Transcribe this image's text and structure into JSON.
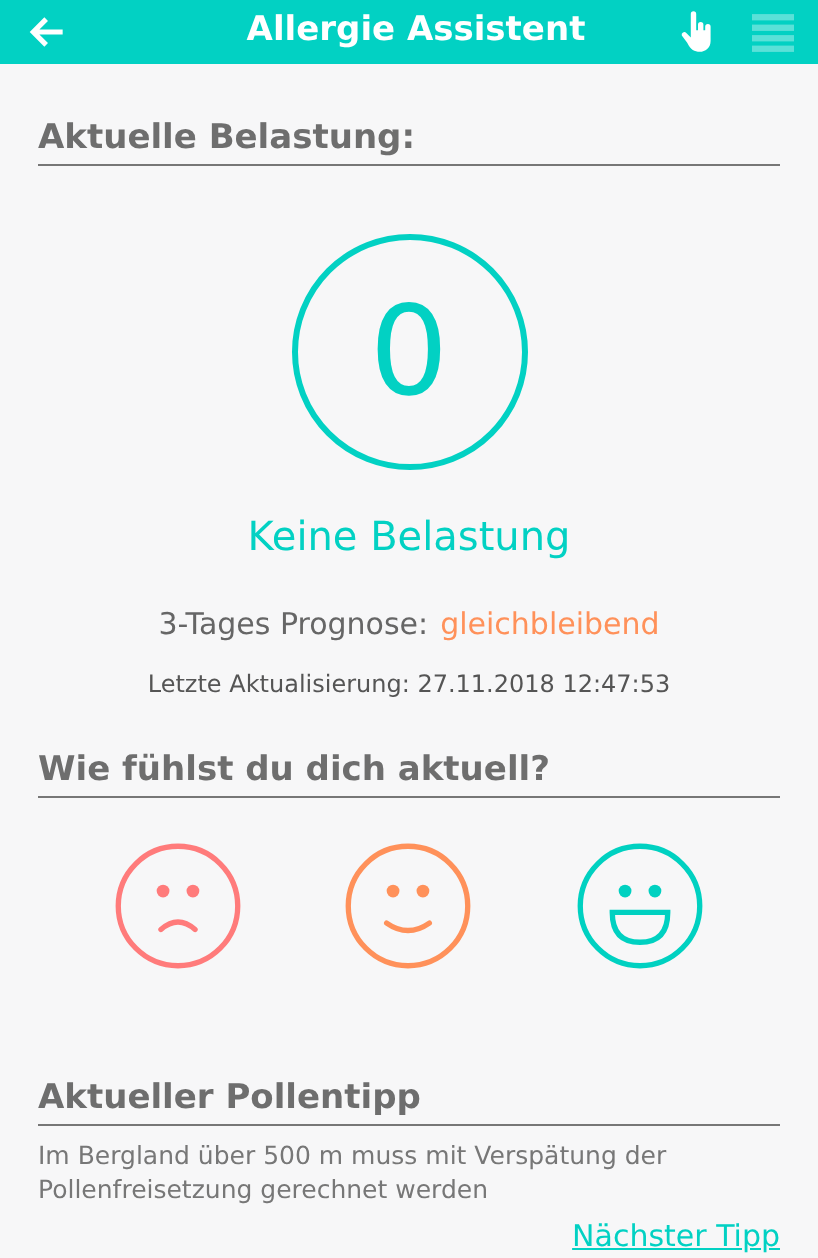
{
  "header": {
    "title": "Allergie Assistent"
  },
  "load": {
    "heading": "Aktuelle Belastung:",
    "value": "0",
    "label": "Keine Belastung",
    "forecast_label": "3-Tages Prognose:",
    "forecast_value": "gleichbleibend",
    "updated": "Letzte Aktualisierung: 27.11.2018 12:47:53"
  },
  "mood": {
    "heading": "Wie fühlst du dich aktuell?",
    "options": [
      {
        "kind": "sad",
        "color": "#ff7b7b"
      },
      {
        "kind": "neutral",
        "color": "#ff915a"
      },
      {
        "kind": "happy",
        "color": "#00d1c1"
      }
    ]
  },
  "tip": {
    "heading": "Aktueller Pollentipp",
    "text": "Im Bergland über 500 m muss mit Verspätung der Pollenfreisetzung gerechnet werden",
    "link": "Nächster Tipp"
  }
}
